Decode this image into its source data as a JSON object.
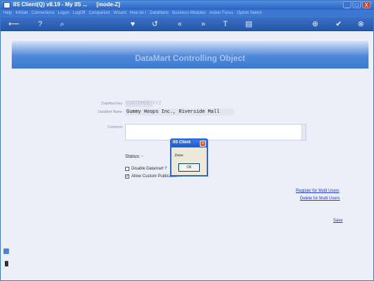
{
  "window": {
    "title": "IIS Client(Q) v8.19 - My IIS ...      [mode-Z]",
    "controls": [
      "_",
      "□",
      "X"
    ]
  },
  "menu": [
    "Help",
    "Infolab",
    "Connections",
    "Logon",
    "LogOff",
    "Companion",
    "Wizard",
    "How do I",
    "DataMarts",
    "Business Modules",
    "Action Focus",
    "Option Select"
  ],
  "toolbar": {
    "icons": [
      "back-arrow-icon",
      "help-icon",
      "search-icon",
      "heart-icon",
      "refresh-icon",
      "rewind-icon",
      "fast-forward-icon",
      "text-icon",
      "clipboard-icon",
      "add-icon",
      "check-icon",
      "close-icon"
    ]
  },
  "page": {
    "title": "DataMart Controlling Object"
  },
  "form": {
    "datamart_key_label": "DataMart Key",
    "datamart_key_value": "CUSTOMER/XYZ",
    "datamart_name_label": "DataMart Name",
    "datamart_name_value": "Gummy Hoops Inc., Riverside Mall",
    "comment_label": "Comment",
    "comment_value": "",
    "status_label": "Status: -",
    "disable_label": "Disable Datamart ?",
    "disable_checked": false,
    "allow_label": "Allow Custom Publication ?",
    "allow_checked": true
  },
  "links": {
    "register": "Register for Multi Users",
    "delete": "Delete for Multi Users",
    "save": "Save"
  },
  "dialog": {
    "title": "IIS Client",
    "message": "Done",
    "ok_label": "OK"
  }
}
